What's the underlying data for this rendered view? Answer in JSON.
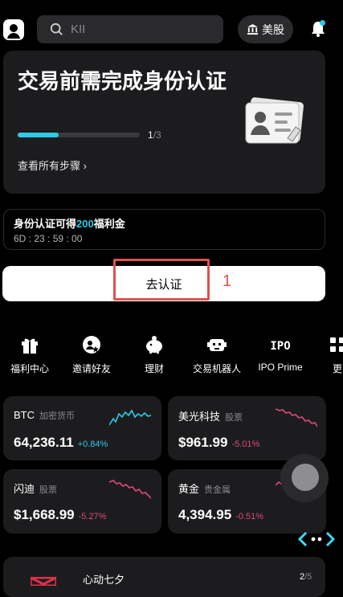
{
  "header": {
    "search_placeholder": "KII",
    "market_label": "美股"
  },
  "verify_card": {
    "title": "交易前需完成身份认证",
    "progress_current": "1",
    "progress_total": "/3",
    "progress_fraction": 0.333,
    "steps_link": "查看所有步骤 ›"
  },
  "bonus": {
    "title_before": "身份认证可得",
    "title_highlight": "200",
    "title_after": "福利金",
    "countdown": "6D : 23 : 59 : 00"
  },
  "cta": {
    "label": "去认证",
    "annotation": "1"
  },
  "shortcuts": [
    {
      "label": "福利中心",
      "icon": "gift-icon"
    },
    {
      "label": "邀请好友",
      "icon": "invite-icon"
    },
    {
      "label": "理财",
      "icon": "piggy-bank-icon"
    },
    {
      "label": "交易机器人",
      "icon": "robot-icon"
    },
    {
      "label": "IPO Prime",
      "icon": "ipo-icon"
    },
    {
      "label": "更",
      "icon": "more-icon"
    }
  ],
  "tickers": [
    {
      "name": "BTC",
      "category": "加密货币",
      "price": "64,236.11",
      "change": "+0.84%",
      "trend": "up"
    },
    {
      "name": "美光科技",
      "category": "股票",
      "price": "$961.99",
      "change": "-5.01%",
      "trend": "down"
    },
    {
      "name": "闪迪",
      "category": "股票",
      "price": "$1,668.99",
      "change": "-5.27%",
      "trend": "down"
    },
    {
      "name": "黄金",
      "category": "贵金属",
      "price": "4,394.95",
      "change": "-0.51%",
      "trend": "down"
    }
  ],
  "bottom_card": {
    "title": "心动七夕",
    "page_current": "2",
    "page_total": "/5"
  },
  "colors": {
    "accent": "#2dc9e8",
    "down": "#e0487a",
    "annotation": "#e05050",
    "card_bg": "#1c1c1e"
  }
}
